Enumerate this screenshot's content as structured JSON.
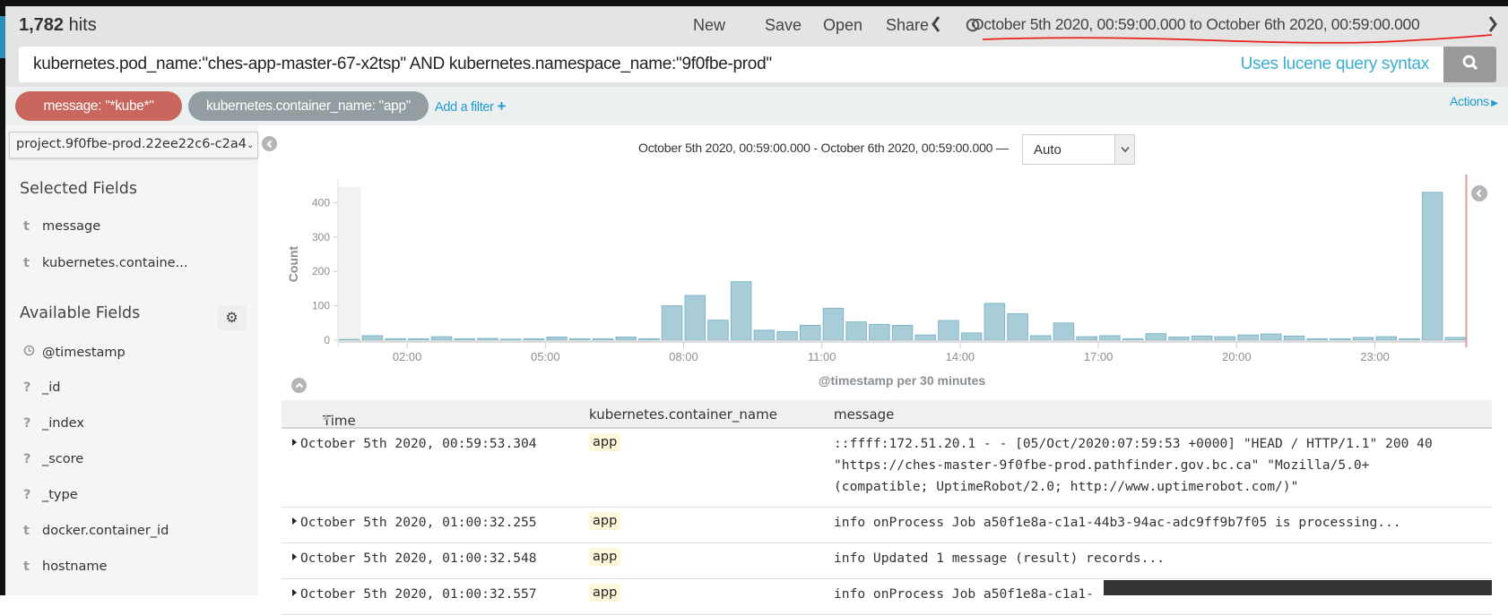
{
  "header": {
    "hits_count": "1,782",
    "hits_label": " hits",
    "menu": [
      "New",
      "Save",
      "Open",
      "Share"
    ],
    "time_range": "October 5th 2020, 00:59:00.000 to October 6th 2020, 00:59:00.000",
    "annotation_color": "#e8221d"
  },
  "query": {
    "value": "kubernetes.pod_name:\"ches-app-master-67-x2tsp\" AND kubernetes.namespace_name:\"9f0fbe-prod\"",
    "syntax_hint": "Uses lucene query syntax"
  },
  "filters": {
    "pills": [
      {
        "label": "message: \"*kube*\"",
        "color": "#c9665d"
      },
      {
        "label": "kubernetes.container_name: \"app\"",
        "color": "#929ea1"
      }
    ],
    "add_label": "Add a filter",
    "actions_label": "Actions"
  },
  "sidebar": {
    "index_pattern": "project.9f0fbe-prod.22ee22c6-c2a4",
    "selected_title": "Selected Fields",
    "selected_fields": [
      {
        "type": "t",
        "name": "message"
      },
      {
        "type": "t",
        "name": "kubernetes.containe..."
      }
    ],
    "available_title": "Available Fields",
    "available_fields": [
      {
        "type": "clock",
        "name": "@timestamp"
      },
      {
        "type": "?",
        "name": "_id"
      },
      {
        "type": "?",
        "name": "_index"
      },
      {
        "type": "?",
        "name": "_score"
      },
      {
        "type": "?",
        "name": "_type"
      },
      {
        "type": "t",
        "name": "docker.container_id"
      },
      {
        "type": "t",
        "name": "hostname"
      }
    ]
  },
  "histogram": {
    "range_label": "October 5th 2020, 00:59:00.000 - October 6th 2020, 00:59:00.000 —",
    "interval": "Auto"
  },
  "chart_data": {
    "type": "bar",
    "ylabel": "Count",
    "xlabel": "@timestamp per 30 minutes",
    "ylim": [
      0,
      450
    ],
    "yticks": [
      "0",
      "100",
      "200",
      "300",
      "400"
    ],
    "xticks": [
      "02:00",
      "05:00",
      "08:00",
      "11:00",
      "14:00",
      "17:00",
      "20:00",
      "23:00"
    ],
    "bar_color": "#a8cdd9",
    "range_end_marker_color": "#e89a9a",
    "categories": [
      "00:30",
      "01:00",
      "01:30",
      "02:00",
      "02:30",
      "03:00",
      "03:30",
      "04:00",
      "04:30",
      "05:00",
      "05:30",
      "06:00",
      "06:30",
      "07:00",
      "07:30",
      "08:00",
      "08:30",
      "09:00",
      "09:30",
      "10:00",
      "10:30",
      "11:00",
      "11:30",
      "12:00",
      "12:30",
      "13:00",
      "13:30",
      "14:00",
      "14:30",
      "15:00",
      "15:30",
      "16:00",
      "16:30",
      "17:00",
      "17:30",
      "18:00",
      "18:30",
      "19:00",
      "19:30",
      "20:00",
      "20:30",
      "21:00",
      "21:30",
      "22:00",
      "22:30",
      "23:00",
      "23:30",
      "00:00",
      "00:30"
    ],
    "values": [
      2,
      13,
      4,
      4,
      10,
      4,
      5,
      3,
      4,
      9,
      4,
      4,
      9,
      4,
      100,
      130,
      58,
      170,
      29,
      25,
      43,
      93,
      53,
      46,
      43,
      15,
      57,
      21,
      107,
      77,
      13,
      50,
      10,
      13,
      4,
      19,
      9,
      12,
      10,
      15,
      18,
      12,
      4,
      4,
      8,
      10,
      4,
      430,
      8
    ]
  },
  "table": {
    "columns": [
      "Time",
      "kubernetes.container_name",
      "message"
    ],
    "rows": [
      {
        "time": "October 5th 2020, 00:59:53.304",
        "container": "app",
        "message": [
          "::ffff:172.51.20.1 - - [05/Oct/2020:07:59:53 +0000] \"HEAD / HTTP/1.1\" 200 40",
          "\"https://ches-master-9f0fbe-prod.pathfinder.gov.bc.ca\" \"Mozilla/5.0+",
          "(compatible; UptimeRobot/2.0; http://www.uptimerobot.com/)\""
        ]
      },
      {
        "time": "October 5th 2020, 01:00:32.255",
        "container": "app",
        "message": [
          "info onProcess Job a50f1e8a-c1a1-44b3-94ac-adc9ff9b7f05 is processing..."
        ]
      },
      {
        "time": "October 5th 2020, 01:00:32.548",
        "container": "app",
        "message": [
          "info Updated 1 message (result) records..."
        ]
      },
      {
        "time": "October 5th 2020, 01:00:32.557",
        "container": "app",
        "message": [
          "info onProcess Job a50f1e8a-c1a1-"
        ]
      }
    ]
  }
}
